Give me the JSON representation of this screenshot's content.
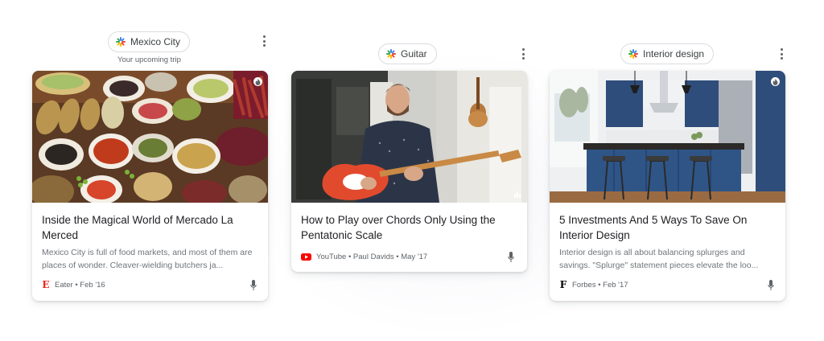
{
  "columns": [
    {
      "chip_label": "Mexico City",
      "chip_subtitle": "Your upcoming trip",
      "card": {
        "title": "Inside the Magical World of Mercado La Merced",
        "snippet": "Mexico City is full of food markets, and most of them are places of wonder. Cleaver-wielding butchers ja...",
        "source": "Eater • Feb '16",
        "source_logo": "E",
        "logo_color": "#e8281e",
        "image": "market-food-photo",
        "badge_icon": "fire-badge-icon"
      }
    },
    {
      "chip_label": "Guitar",
      "card": {
        "title": "How to Play over Chords Only Using the Pentatonic Scale",
        "source": "YouTube • Paul Davids • May '17",
        "source_logo": "youtube-logo",
        "logo_color": "#ff0000",
        "image": "guitarist-photo",
        "badge_icon": "bar-chart-icon"
      }
    },
    {
      "chip_label": "Interior design",
      "card": {
        "title": "5 Investments And 5 Ways To Save On Interior Design",
        "snippet": "Interior design is all about balancing splurges and savings. \"Splurge\" statement pieces elevate the loo...",
        "source": "Forbes • Feb '17",
        "source_logo": "F",
        "logo_color": "#000000",
        "image": "blue-kitchen-photo",
        "badge_icon": "fire-badge-icon"
      }
    }
  ],
  "colors": {
    "spark_blue": "#4285f4",
    "spark_red": "#ea4335",
    "spark_yellow": "#fbbc05",
    "spark_green": "#34a853",
    "text_primary": "#202124",
    "text_secondary": "#70757a"
  },
  "icons": {
    "chip_icon": "google-spark-icon",
    "menu_icon": "more-vert-icon",
    "mic_icon": "mic-icon"
  }
}
